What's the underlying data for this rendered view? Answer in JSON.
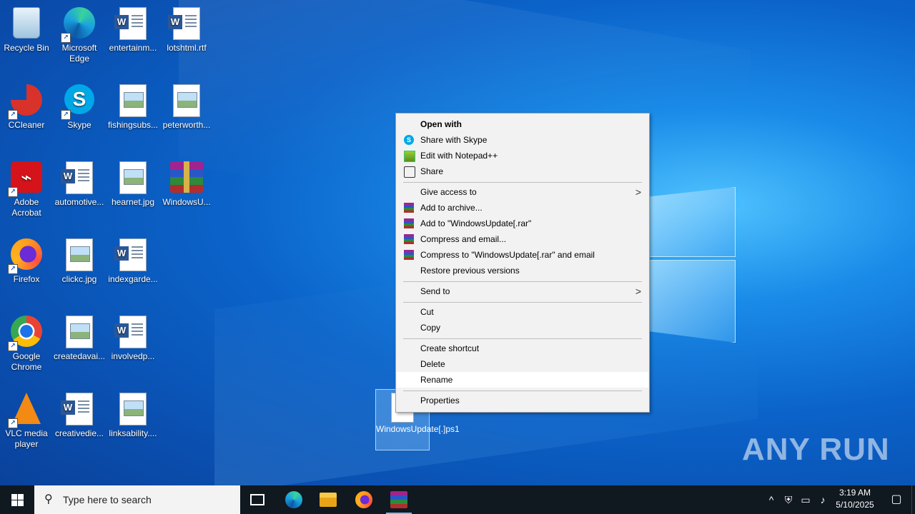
{
  "desktop": {
    "icons": [
      {
        "label": "Recycle Bin",
        "icon": "recycle-bin-icon"
      },
      {
        "label": "Microsoft Edge",
        "icon": "edge-icon"
      },
      {
        "label": "entertainm...",
        "icon": "word-doc-icon"
      },
      {
        "label": "lotshtml.rtf",
        "icon": "word-doc-icon"
      },
      {
        "label": "CCleaner",
        "icon": "ccleaner-icon"
      },
      {
        "label": "Skype",
        "icon": "skype-icon"
      },
      {
        "label": "fishingsubs...",
        "icon": "image-file-icon"
      },
      {
        "label": "peterworth...",
        "icon": "image-file-icon"
      },
      {
        "label": "Adobe Acrobat",
        "icon": "acrobat-icon"
      },
      {
        "label": "automotive...",
        "icon": "word-doc-icon"
      },
      {
        "label": "hearnet.jpg",
        "icon": "image-file-icon"
      },
      {
        "label": "WindowsU...",
        "icon": "winrar-archive-icon"
      },
      {
        "label": "Firefox",
        "icon": "firefox-icon"
      },
      {
        "label": "clickc.jpg",
        "icon": "image-file-icon"
      },
      {
        "label": "indexgarde...",
        "icon": "word-doc-icon"
      },
      {
        "label": "Google Chrome",
        "icon": "chrome-icon"
      },
      {
        "label": "createdavai...",
        "icon": "image-file-icon"
      },
      {
        "label": "involvedp...",
        "icon": "word-doc-icon"
      },
      {
        "label": "VLC media player",
        "icon": "vlc-icon"
      },
      {
        "label": "creativedie...",
        "icon": "word-doc-icon"
      },
      {
        "label": "linksability....",
        "icon": "image-file-icon"
      }
    ],
    "selected_file": {
      "label": "WindowsUpdate[.]ps1"
    }
  },
  "context_menu": {
    "open_with": "Open with",
    "share_skype": "Share with Skype",
    "edit_notepad": "Edit with Notepad++",
    "share": "Share",
    "give_access": "Give access to",
    "add_archive": "Add to archive...",
    "add_to_rar": "Add to \"WindowsUpdate[.rar\"",
    "compress_email": "Compress and email...",
    "compress_rar_email": "Compress to \"WindowsUpdate[.rar\" and email",
    "restore": "Restore previous versions",
    "send_to": "Send to",
    "cut": "Cut",
    "copy": "Copy",
    "create_shortcut": "Create shortcut",
    "delete": "Delete",
    "rename": "Rename",
    "properties": "Properties"
  },
  "watermark": "ANY RUN",
  "taskbar": {
    "search_placeholder": "Type here to search",
    "time": "3:19 AM",
    "date": "5/10/2025"
  }
}
